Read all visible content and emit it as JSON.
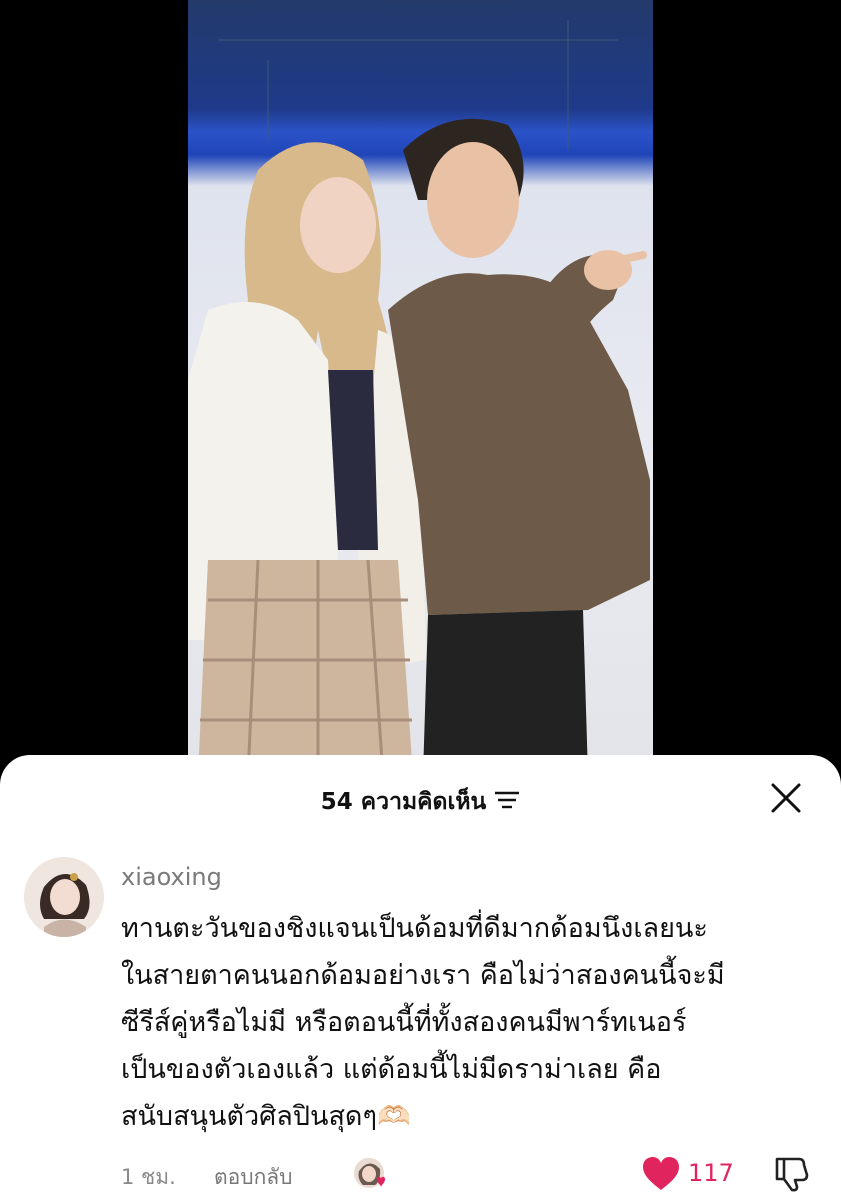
{
  "comments_panel": {
    "count_label": "54 ความคิดเห็น",
    "sort_icon": "sort-lines-icon",
    "close_icon": "close-x-icon"
  },
  "comment": {
    "username": "xiaoxing",
    "text": "ทานตะวันของชิงแจนเป็นด้อมที่ดีมากด้อมนึงเลยนะ\nในสายตาคนนอกด้อมอย่างเรา คือไม่ว่าสองคนนี้จะมี\nซีรีส์คู่หรือไม่มี หรือตอนนี้ที่ทั้งสองคนมีพาร์ทเนอร์\nเป็นของตัวเองแล้ว แต่ด้อมนี้ไม่มีดราม่าเลย คือ\nสนับสนุนตัวศิลปินสุดๆ🫶🏻",
    "time": "1 ชม.",
    "reply_label": "ตอบกลับ",
    "like_count": "117",
    "like_color": "#e0245e"
  }
}
